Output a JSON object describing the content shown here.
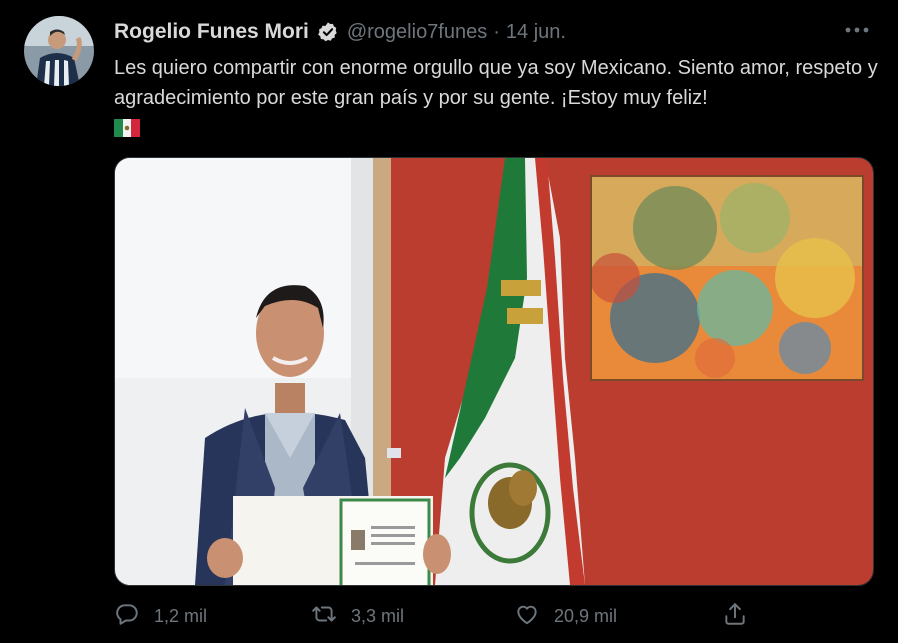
{
  "tweet": {
    "author_name": "Rogelio Funes Mori",
    "handle": "@rogelio7funes",
    "separator": "·",
    "date": "14 jun.",
    "text": "Les quiero compartir con enorme orgullo que ya soy Mexicano. Siento amor, respeto y agradecimiento por este gran país y por su gente. ¡Estoy muy feliz!",
    "flag_emoji": "mexico-flag-emoji"
  },
  "actions": {
    "reply_count": "1,2 mil",
    "retweet_count": "3,3 mil",
    "like_count": "20,9 mil"
  },
  "icons": {
    "verified": "verified-badge-icon",
    "more": "more-icon",
    "reply": "reply-icon",
    "retweet": "retweet-icon",
    "like": "heart-icon",
    "share": "share-icon"
  },
  "colors": {
    "background": "#000000",
    "text": "#d9d9d9",
    "secondary": "#6e767d",
    "wall_red": "#b63a2d",
    "flag_green": "#1f7a3a"
  }
}
